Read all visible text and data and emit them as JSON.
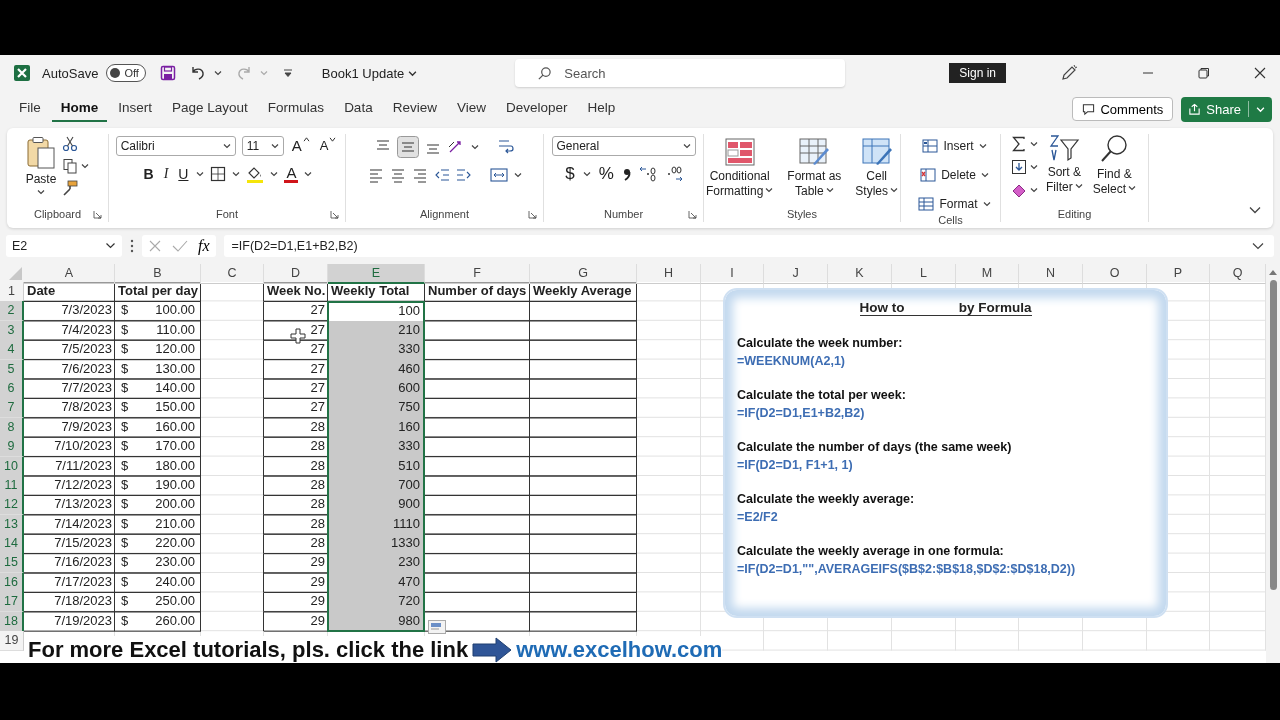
{
  "title_bar": {
    "autosave_label": "AutoSave",
    "autosave_on": false,
    "autosave_state": "Off",
    "document_title": "Book1 Update",
    "search_placeholder": "Search",
    "sign_in": "Sign in"
  },
  "menu_tabs": [
    {
      "label": "File",
      "selected": false
    },
    {
      "label": "Home",
      "selected": true
    },
    {
      "label": "Insert",
      "selected": false
    },
    {
      "label": "Page Layout",
      "selected": false
    },
    {
      "label": "Formulas",
      "selected": false
    },
    {
      "label": "Data",
      "selected": false
    },
    {
      "label": "Review",
      "selected": false
    },
    {
      "label": "View",
      "selected": false
    },
    {
      "label": "Developer",
      "selected": false
    },
    {
      "label": "Help",
      "selected": false
    }
  ],
  "comments": "Comments",
  "share": "Share",
  "ribbon": {
    "clipboard": {
      "label": "Clipboard",
      "paste": "Paste"
    },
    "font": {
      "label": "Font",
      "font_name": "Calibri",
      "font_size": "11",
      "grow": "A",
      "shrink": "A",
      "bold": "B",
      "italic": "I",
      "underline": "U",
      "font_color": "A"
    },
    "alignment": {
      "label": "Alignment"
    },
    "number": {
      "label": "Number",
      "format": "General",
      "currency": "$",
      "percent": "%"
    },
    "styles": {
      "label": "Styles",
      "buttons": [
        {
          "kind": "conditional",
          "lines": [
            "Conditional",
            "Formatting"
          ]
        },
        {
          "kind": "table",
          "lines": [
            "Format as",
            "Table"
          ]
        },
        {
          "kind": "cellstyles",
          "lines": [
            "Cell",
            "Styles"
          ]
        }
      ]
    },
    "cells": {
      "label": "Cells",
      "buttons": [
        {
          "kind": "insert",
          "label": "Insert"
        },
        {
          "kind": "delete",
          "label": "Delete"
        },
        {
          "kind": "format",
          "label": "Format"
        }
      ]
    },
    "editing": {
      "label": "Editing",
      "buttons": [
        {
          "kind": "sort",
          "lines": [
            "Sort &",
            "Filter"
          ]
        },
        {
          "kind": "find",
          "lines": [
            "Find &",
            "Select"
          ]
        }
      ]
    }
  },
  "formula_bar": {
    "name_box": "E2",
    "fx": "fx",
    "formula": "=IF(D2=D1,E1+B2,B2)"
  },
  "sheet": {
    "columns": [
      {
        "label": "A",
        "selected": false
      },
      {
        "label": "B",
        "selected": false
      },
      {
        "label": "C",
        "selected": false
      },
      {
        "label": "D",
        "selected": false
      },
      {
        "label": "E",
        "selected": true
      },
      {
        "label": "F",
        "selected": false
      },
      {
        "label": "G",
        "selected": false
      },
      {
        "label": "H",
        "selected": false
      },
      {
        "label": "I",
        "selected": false
      },
      {
        "label": "J",
        "selected": false
      },
      {
        "label": "K",
        "selected": false
      },
      {
        "label": "L",
        "selected": false
      },
      {
        "label": "M",
        "selected": false
      },
      {
        "label": "N",
        "selected": false
      },
      {
        "label": "O",
        "selected": false
      },
      {
        "label": "P",
        "selected": false
      },
      {
        "label": "Q",
        "selected": false
      }
    ],
    "rows": [
      {
        "number": "1",
        "kind": "header",
        "selected": false,
        "a": "Date",
        "b": "Total per day",
        "d": "Week No.",
        "e": "Weekly Total",
        "f": "Number of days",
        "g": "Weekly Average"
      },
      {
        "number": "2",
        "kind": "data",
        "selected": true,
        "active": true,
        "a": "7/3/2023",
        "b_currency": "$",
        "b_amount": "100.00",
        "d": "27",
        "e": "100"
      },
      {
        "number": "3",
        "kind": "data",
        "selected": true,
        "active": false,
        "a": "7/4/2023",
        "b_currency": "$",
        "b_amount": "110.00",
        "d": "27",
        "e": "210"
      },
      {
        "number": "4",
        "kind": "data",
        "selected": true,
        "active": false,
        "a": "7/5/2023",
        "b_currency": "$",
        "b_amount": "120.00",
        "d": "27",
        "e": "330"
      },
      {
        "number": "5",
        "kind": "data",
        "selected": true,
        "active": false,
        "a": "7/6/2023",
        "b_currency": "$",
        "b_amount": "130.00",
        "d": "27",
        "e": "460"
      },
      {
        "number": "6",
        "kind": "data",
        "selected": true,
        "active": false,
        "a": "7/7/2023",
        "b_currency": "$",
        "b_amount": "140.00",
        "d": "27",
        "e": "600"
      },
      {
        "number": "7",
        "kind": "data",
        "selected": true,
        "active": false,
        "a": "7/8/2023",
        "b_currency": "$",
        "b_amount": "150.00",
        "d": "27",
        "e": "750"
      },
      {
        "number": "8",
        "kind": "data",
        "selected": true,
        "active": false,
        "a": "7/9/2023",
        "b_currency": "$",
        "b_amount": "160.00",
        "d": "28",
        "e": "160"
      },
      {
        "number": "9",
        "kind": "data",
        "selected": true,
        "active": false,
        "a": "7/10/2023",
        "b_currency": "$",
        "b_amount": "170.00",
        "d": "28",
        "e": "330"
      },
      {
        "number": "10",
        "kind": "data",
        "selected": true,
        "active": false,
        "a": "7/11/2023",
        "b_currency": "$",
        "b_amount": "180.00",
        "d": "28",
        "e": "510"
      },
      {
        "number": "11",
        "kind": "data",
        "selected": true,
        "active": false,
        "a": "7/12/2023",
        "b_currency": "$",
        "b_amount": "190.00",
        "d": "28",
        "e": "700"
      },
      {
        "number": "12",
        "kind": "data",
        "selected": true,
        "active": false,
        "a": "7/13/2023",
        "b_currency": "$",
        "b_amount": "200.00",
        "d": "28",
        "e": "900"
      },
      {
        "number": "13",
        "kind": "data",
        "selected": true,
        "active": false,
        "a": "7/14/2023",
        "b_currency": "$",
        "b_amount": "210.00",
        "d": "28",
        "e": "1110"
      },
      {
        "number": "14",
        "kind": "data",
        "selected": true,
        "active": false,
        "a": "7/15/2023",
        "b_currency": "$",
        "b_amount": "220.00",
        "d": "28",
        "e": "1330"
      },
      {
        "number": "15",
        "kind": "data",
        "selected": true,
        "active": false,
        "a": "7/16/2023",
        "b_currency": "$",
        "b_amount": "230.00",
        "d": "29",
        "e": "230"
      },
      {
        "number": "16",
        "kind": "data",
        "selected": true,
        "active": false,
        "a": "7/17/2023",
        "b_currency": "$",
        "b_amount": "240.00",
        "d": "29",
        "e": "470"
      },
      {
        "number": "17",
        "kind": "data",
        "selected": true,
        "active": false,
        "a": "7/18/2023",
        "b_currency": "$",
        "b_amount": "250.00",
        "d": "29",
        "e": "720"
      },
      {
        "number": "18",
        "kind": "data",
        "selected": true,
        "active": false,
        "a": "7/19/2023",
        "b_currency": "$",
        "b_amount": "260.00",
        "d": "29",
        "e": "980"
      },
      {
        "number": "19",
        "kind": "blank",
        "selected": false
      }
    ]
  },
  "text_box": {
    "title_start": "How to",
    "title_end": "by Formula",
    "sections": [
      {
        "heading": "Calculate the week number:",
        "formula": "=WEEKNUM(A2,1)"
      },
      {
        "heading": "Calculate the total per week:",
        "formula": "=IF(D2=D1,E1+B2,B2)"
      },
      {
        "heading": "Calculate the number of days (the same week)",
        "formula": "=IF(D2=D1, F1+1, 1)"
      },
      {
        "heading": "Calculate the weekly average:",
        "formula": "=E2/F2"
      },
      {
        "heading": "Calculate the weekly average in one formula:",
        "formula": "=IF(D2=D1,\"\",AVERAGEIFS($B$2:$B$18,$D$2:$D$18,D2))"
      }
    ]
  },
  "banner": {
    "text": "For more Excel tutorials, pls. click the link",
    "url": "www.excelhow.com"
  }
}
